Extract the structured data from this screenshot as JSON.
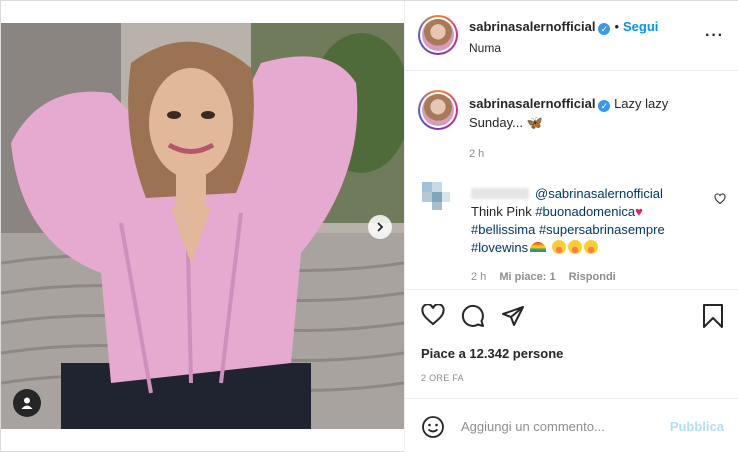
{
  "post": {
    "username": "sabrinasalernofficial",
    "verified": true,
    "follow_label": "Segui",
    "location": "Numa",
    "more_icon": "more-options-icon"
  },
  "caption": {
    "username": "sabrinasalernofficial",
    "text": "Lazy lazy Sunday...",
    "emoji": "🦋",
    "time": "2 h"
  },
  "comment": {
    "mention": "@sabrinasalernofficial",
    "line1": "Think Pink",
    "tag1": "#buonadomenica",
    "tag2": "#bellissima",
    "tag3": "#supersabrinasempre",
    "tag4": "#lovewins",
    "time": "2 h",
    "likes": "Mi piace: 1",
    "reply": "Rispondi"
  },
  "engagement": {
    "likes_text": "Piace a 12.342 persone",
    "time_ago": "2 ORE FA"
  },
  "add_comment": {
    "placeholder": "Aggiungi un commento...",
    "publish": "Pubblica"
  },
  "colors": {
    "accent": "#0095f6",
    "link": "#00376b",
    "verified": "#3897f0",
    "publish_disabled": "#b2dffc"
  }
}
